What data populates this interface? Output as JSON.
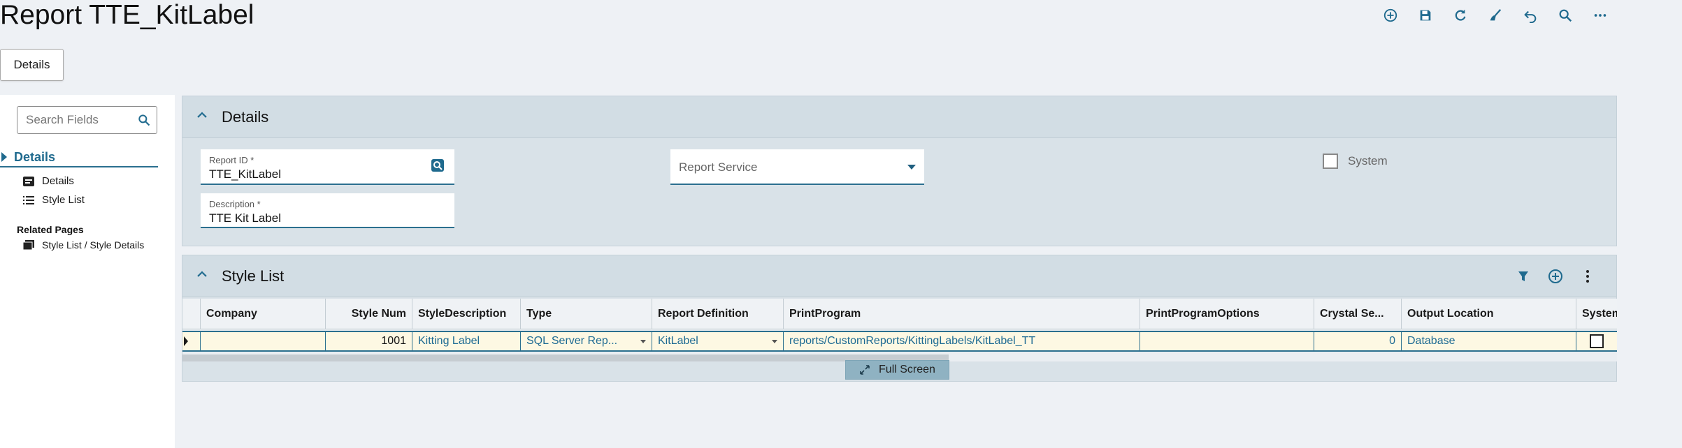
{
  "page": {
    "title": "Report TTE_KitLabel"
  },
  "toolbar": {
    "icons": [
      "add-icon",
      "save-icon",
      "refresh-icon",
      "clear-icon",
      "undo-icon",
      "search-icon",
      "more-icon"
    ]
  },
  "tab": {
    "details_label": "Details"
  },
  "leftnav": {
    "search_placeholder": "Search Fields",
    "section_label": "Details",
    "items": [
      {
        "label": "Details",
        "icon": "form-icon"
      },
      {
        "label": "Style List",
        "icon": "list-icon"
      }
    ],
    "related_title": "Related Pages",
    "related_items": [
      {
        "label": "Style List / Style Details",
        "icon": "pages-icon"
      }
    ]
  },
  "details_panel": {
    "title": "Details",
    "report_id": {
      "label": "Report ID *",
      "value": "TTE_KitLabel"
    },
    "description": {
      "label": "Description *",
      "value": "TTE Kit Label"
    },
    "report_service": {
      "placeholder": "Report Service"
    },
    "system": {
      "label": "System",
      "checked": false
    }
  },
  "style_panel": {
    "title": "Style List",
    "columns": [
      "Company",
      "Style Num",
      "StyleDescription",
      "Type",
      "Report Definition",
      "PrintProgram",
      "PrintProgramOptions",
      "Crystal Se...",
      "Output Location",
      "SystemFl"
    ],
    "row": {
      "company": "",
      "style_num": "1001",
      "style_description": "Kitting Label",
      "type": "SQL Server Rep...",
      "report_definition": "KitLabel",
      "print_program": "reports/CustomReports/KittingLabels/KitLabel_TT",
      "print_program_options": "",
      "crystal": "0",
      "output_location": "Database",
      "system_flag": false
    },
    "fullscreen_label": "Full Screen"
  },
  "colors": {
    "accent": "#1f6a8e",
    "panel_bg": "#d9e2e8",
    "row_highlight": "#fdf8e3"
  }
}
